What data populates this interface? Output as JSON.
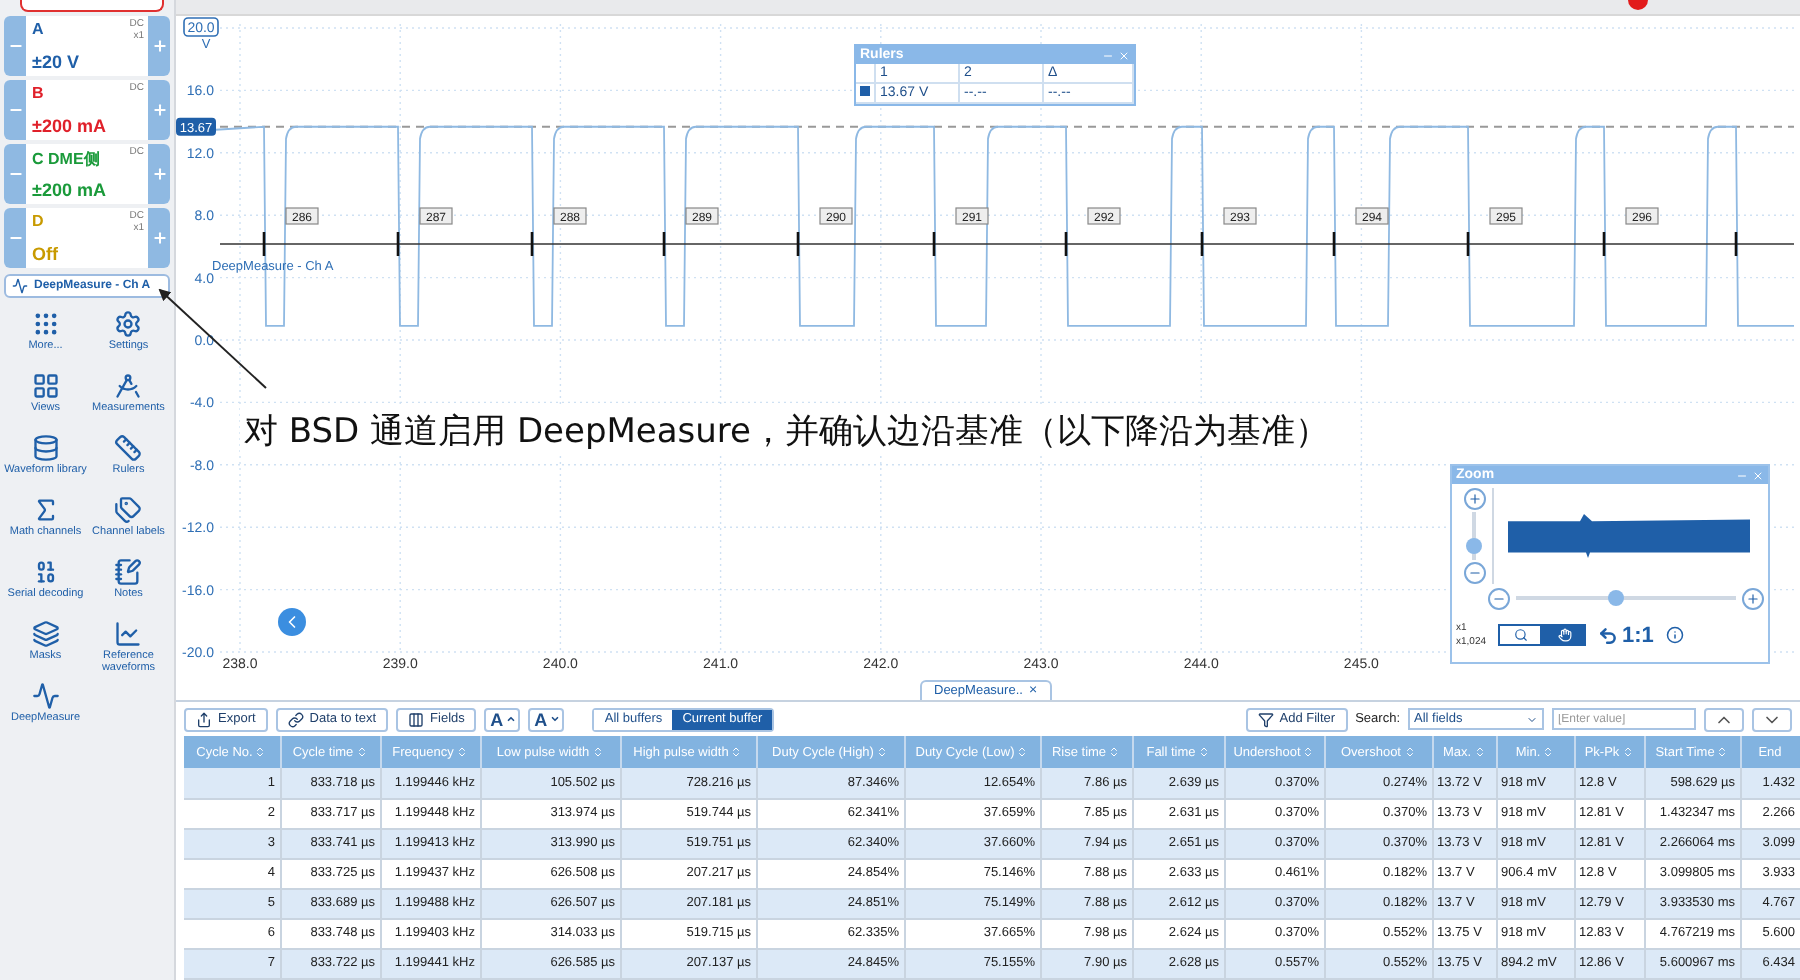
{
  "channels": [
    {
      "label": "A",
      "coupling": "DC",
      "probe": "x1",
      "range": "±20 V",
      "color": "#1f5fa8"
    },
    {
      "label": "B",
      "coupling": "DC",
      "range": "±200 mA",
      "color": "#e0202a"
    },
    {
      "label": "C DME侧",
      "coupling": "DC",
      "range": "±200 mA",
      "color": "#1a9a3a"
    },
    {
      "label": "D",
      "coupling": "DC",
      "probe": "x1",
      "range": "Off",
      "color": "#c89a00"
    }
  ],
  "deepmeasure_button": "DeepMeasure - Ch A",
  "tools": [
    "More...",
    "Settings",
    "Views",
    "Measurements",
    "Waveform library",
    "Rulers",
    "Math channels",
    "Channel labels",
    "Serial decoding",
    "Notes",
    "Masks",
    "Reference waveforms",
    "DeepMeasure"
  ],
  "chart": {
    "y_unit": "V",
    "y_labels": [
      "20.0",
      "16.0",
      "12.0",
      "8.0",
      "4.0",
      "0.0",
      "-4.0",
      "-8.0",
      "-12.0",
      "-16.0",
      "-20.0"
    ],
    "x_labels": [
      "238.0",
      "239.0",
      "240.0",
      "241.0",
      "242.0",
      "243.0",
      "244.0",
      "245.0"
    ],
    "ruler_level": "13.67",
    "trace_label": "DeepMeasure - Ch A",
    "cycle_labels": [
      "286",
      "287",
      "288",
      "289",
      "290",
      "291",
      "292",
      "293",
      "294",
      "295",
      "296"
    ]
  },
  "rulers": {
    "title": "Rulers",
    "columns": [
      "1",
      "2",
      "Δ"
    ],
    "values": [
      "13.67 V",
      "--.--",
      "--.--"
    ]
  },
  "annotation": "对 BSD 通道启用 DeepMeasure，并确认边沿基准（以下降沿为基准）",
  "zoom": {
    "title": "Zoom",
    "scales": [
      "x1",
      "x1,024"
    ],
    "ratio": "1:1",
    "horizontal_slider": {
      "level": 0.45
    },
    "vertical_slider": {
      "level": 0.3
    },
    "modes": [
      {
        "kind": "zoom",
        "selected": false
      },
      {
        "kind": "pan",
        "selected": true
      }
    ]
  },
  "tab": {
    "label": "DeepMeasure..",
    "close": "×"
  },
  "toolbar": {
    "export": "Export",
    "data_to_text": "Data to text",
    "fields": "Fields",
    "font_buttons": [
      {
        "label": "A",
        "kind": "up"
      },
      {
        "label": "A",
        "kind": "down"
      }
    ],
    "buffers": [
      {
        "label": "All buffers",
        "selected": false
      },
      {
        "label": "Current buffer",
        "selected": true
      }
    ],
    "add_filter": "Add Filter",
    "search_label": "Search:",
    "search_scope": "All fields",
    "placeholder": "[Enter value]"
  },
  "table": {
    "columns": [
      "Cycle No.",
      "Cycle time",
      "Frequency",
      "Low pulse width",
      "High pulse width",
      "Duty Cycle (High)",
      "Duty Cycle (Low)",
      "Rise time",
      "Fall time",
      "Undershoot",
      "Overshoot",
      "Max.",
      "Min.",
      "Pk-Pk",
      "Start Time",
      "End"
    ],
    "rows": [
      [
        "1",
        "833.718 µs",
        "1.199446 kHz",
        "105.502 µs",
        "728.216 µs",
        "87.346%",
        "12.654%",
        "7.86 µs",
        "2.639 µs",
        "0.370%",
        "0.274%",
        "13.72 V",
        "918 mV",
        "12.8 V",
        "598.629 µs",
        "1.432"
      ],
      [
        "2",
        "833.717 µs",
        "1.199448 kHz",
        "313.974 µs",
        "519.744 µs",
        "62.341%",
        "37.659%",
        "7.85 µs",
        "2.631 µs",
        "0.370%",
        "0.370%",
        "13.73 V",
        "918 mV",
        "12.81 V",
        "1.432347 ms",
        "2.266"
      ],
      [
        "3",
        "833.741 µs",
        "1.199413 kHz",
        "313.990 µs",
        "519.751 µs",
        "62.340%",
        "37.660%",
        "7.94 µs",
        "2.651 µs",
        "0.370%",
        "0.370%",
        "13.73 V",
        "918 mV",
        "12.81 V",
        "2.266064 ms",
        "3.099"
      ],
      [
        "4",
        "833.725 µs",
        "1.199437 kHz",
        "626.508 µs",
        "207.217 µs",
        "24.854%",
        "75.146%",
        "7.88 µs",
        "2.633 µs",
        "0.461%",
        "0.182%",
        "13.7 V",
        "906.4 mV",
        "12.8 V",
        "3.099805 ms",
        "3.933"
      ],
      [
        "5",
        "833.689 µs",
        "1.199488 kHz",
        "626.507 µs",
        "207.181 µs",
        "24.851%",
        "75.149%",
        "7.88 µs",
        "2.612 µs",
        "0.370%",
        "0.182%",
        "13.7 V",
        "918 mV",
        "12.79 V",
        "3.933530 ms",
        "4.767"
      ],
      [
        "6",
        "833.748 µs",
        "1.199403 kHz",
        "314.033 µs",
        "519.715 µs",
        "62.335%",
        "37.665%",
        "7.98 µs",
        "2.624 µs",
        "0.370%",
        "0.552%",
        "13.75 V",
        "918 mV",
        "12.83 V",
        "4.767219 ms",
        "5.600"
      ],
      [
        "7",
        "833.722 µs",
        "1.199441 kHz",
        "626.585 µs",
        "207.137 µs",
        "24.845%",
        "75.155%",
        "7.90 µs",
        "2.628 µs",
        "0.557%",
        "0.552%",
        "13.75 V",
        "894.2 mV",
        "12.86 V",
        "5.600967 ms",
        "6.434"
      ]
    ]
  }
}
